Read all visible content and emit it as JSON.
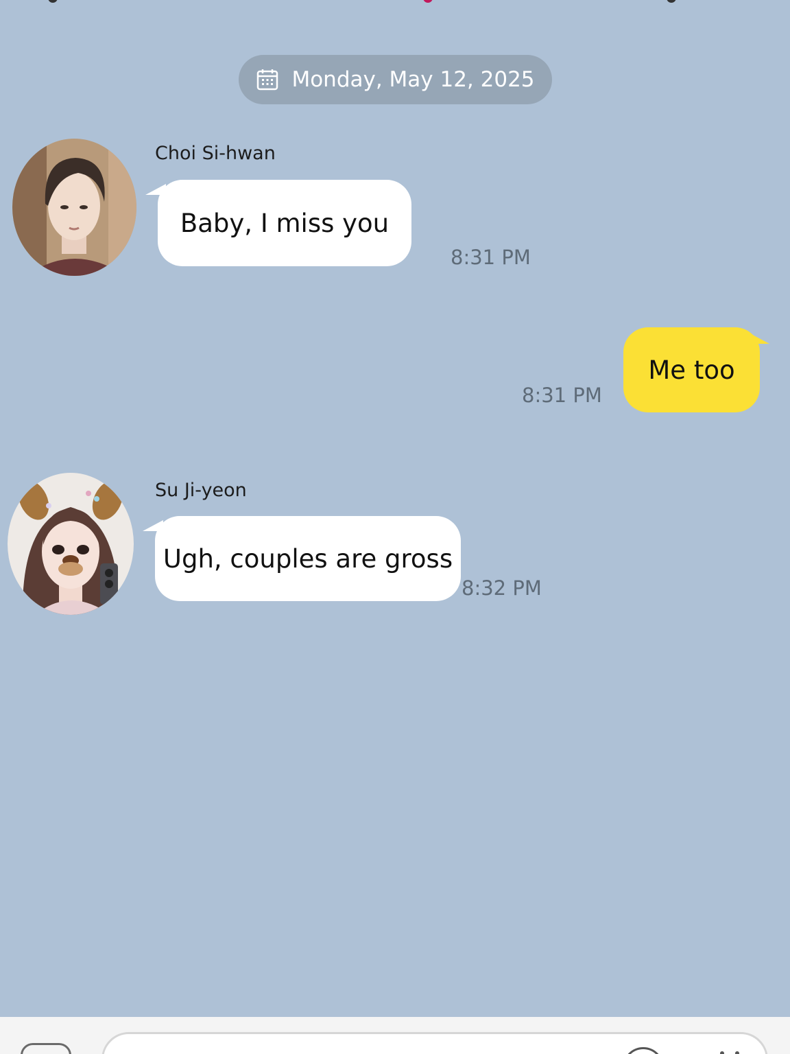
{
  "date_divider": {
    "label": "Monday, May 12, 2025",
    "icon": "calendar-icon"
  },
  "messages": [
    {
      "direction": "incoming",
      "sender": "Choi Si-hwan",
      "avatar": "avatar-choi-si-hwan",
      "text": "Baby, I miss you",
      "time": "8:31 PM"
    },
    {
      "direction": "outgoing",
      "sender": "",
      "text": "Me too",
      "time": "8:31 PM"
    },
    {
      "direction": "incoming",
      "sender": "Su Ji-yeon",
      "avatar": "avatar-su-ji-yeon",
      "text": "Ugh, couples are gross",
      "time": "8:32 PM"
    }
  ],
  "input_bar": {
    "icons": [
      "plus-icon",
      "emoji-icon",
      "more-icon"
    ]
  },
  "colors": {
    "chat_background": "#aec1d6",
    "outgoing_bubble": "#fbe035",
    "incoming_bubble": "#ffffff",
    "date_pill": "#96a6b6",
    "timestamp": "#5e6b78",
    "top_accent": "#c2185b"
  }
}
